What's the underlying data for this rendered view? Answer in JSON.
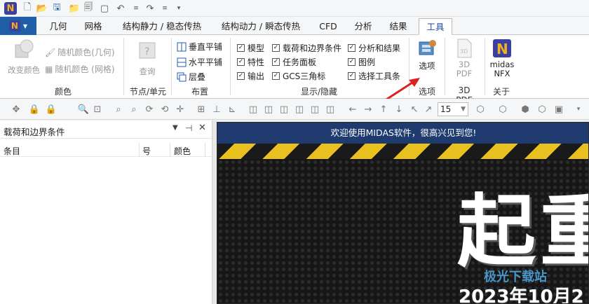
{
  "file_tab": {
    "label": "N"
  },
  "tabs": [
    "几何",
    "网格",
    "结构静力 / 稳态传热",
    "结构动力 / 瞬态传热",
    "CFD",
    "分析",
    "结果",
    "工具"
  ],
  "active_tab": "工具",
  "ribbon": {
    "color_group": {
      "change_color": "改变颜色",
      "random_color_geometry": "随机颜色(几何)",
      "random_color_mesh": "随机颜色 (网格)",
      "label": "颜色"
    },
    "node_group": {
      "query": "查询",
      "label": "节点/单元"
    },
    "layout_group": {
      "vertical_tile": "垂直平铺",
      "horizontal_tile": "水平平铺",
      "cascade": "层叠",
      "label": "布置"
    },
    "show_hide_group": {
      "items": [
        "模型",
        "载荷和边界条件",
        "分析和结果",
        "特性",
        "任务面板",
        "图例",
        "输出",
        "GCS三角标",
        "选择工具条"
      ],
      "label": "显示/隐藏"
    },
    "options_group": {
      "options": "选项",
      "label": "选项"
    },
    "pdf_group": {
      "pdf": "3D PDF",
      "label": "3D PDF"
    },
    "about_group": {
      "nfx": "midas NFX",
      "label": "关于"
    }
  },
  "toolbar": {
    "zoom_value": "15"
  },
  "panel": {
    "title": "载荷和边界条件",
    "columns": [
      "条目",
      "号",
      "颜色"
    ]
  },
  "view": {
    "banner": "欢迎使用MIDAS软件，很高兴见到您!",
    "big_text": "起重",
    "date_text": "2023年10月2",
    "watermark": "极光下载站"
  },
  "colors": {
    "accent": "#1f5fa8",
    "banner_bg": "#1e3a6e",
    "arrow": "#e02020"
  }
}
